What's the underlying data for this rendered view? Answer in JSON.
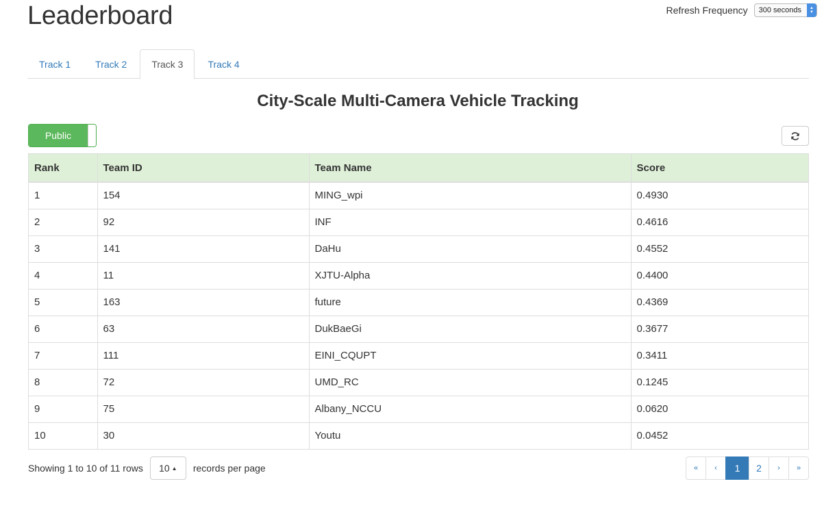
{
  "header": {
    "title": "Leaderboard",
    "refresh_label": "Refresh Frequency",
    "refresh_value": "300 seconds"
  },
  "tabs": [
    {
      "label": "Track 1",
      "active": false
    },
    {
      "label": "Track 2",
      "active": false
    },
    {
      "label": "Track 3",
      "active": true
    },
    {
      "label": "Track 4",
      "active": false
    }
  ],
  "section_title": "City-Scale Multi-Camera Vehicle Tracking",
  "toggle": {
    "label": "Public",
    "state": "on"
  },
  "table": {
    "columns": [
      "Rank",
      "Team ID",
      "Team Name",
      "Score"
    ],
    "rows": [
      [
        "1",
        "154",
        "MING_wpi",
        "0.4930"
      ],
      [
        "2",
        "92",
        "INF",
        "0.4616"
      ],
      [
        "3",
        "141",
        "DaHu",
        "0.4552"
      ],
      [
        "4",
        "11",
        "XJTU-Alpha",
        "0.4400"
      ],
      [
        "5",
        "163",
        "future",
        "0.4369"
      ],
      [
        "6",
        "63",
        "DukBaeGi",
        "0.3677"
      ],
      [
        "7",
        "111",
        "EINI_CQUPT",
        "0.3411"
      ],
      [
        "8",
        "72",
        "UMD_RC",
        "0.1245"
      ],
      [
        "9",
        "75",
        "Albany_NCCU",
        "0.0620"
      ],
      [
        "10",
        "30",
        "Youtu",
        "0.0452"
      ]
    ]
  },
  "footer": {
    "showing_text": "Showing 1 to 10 of 11 rows",
    "page_size": "10",
    "per_page_text": "records per page"
  },
  "pagination": {
    "first": "«",
    "prev": "‹",
    "pages": [
      "1",
      "2"
    ],
    "current": "1",
    "next": "›",
    "last": "»"
  },
  "colors": {
    "link": "#337ab7",
    "header_row": "#dff0d8",
    "toggle_on": "#5cb85c"
  },
  "icons": {
    "refresh_button": "refresh-icon",
    "page_size_caret": "caret-up-icon",
    "select_arrows": "updown-arrows-icon"
  }
}
